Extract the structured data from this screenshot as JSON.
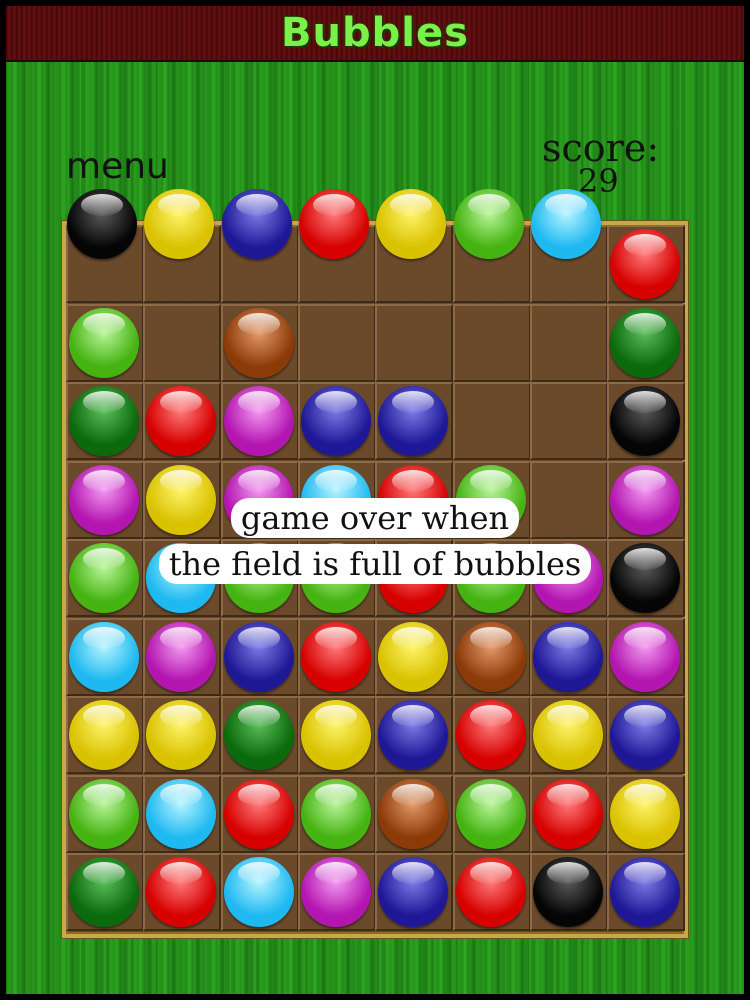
{
  "app": {
    "title": "Bubbles"
  },
  "menu": {
    "label": "menu"
  },
  "score": {
    "label": "score:",
    "value": "29"
  },
  "message": {
    "line1": "game over when",
    "line2": "the field is full of bubbles"
  },
  "colors": {
    "black": [
      "#5a5a5a",
      "#050505"
    ],
    "yellow": [
      "#fff46a",
      "#d9c200"
    ],
    "blue": [
      "#7d7be6",
      "#1e1896"
    ],
    "red": [
      "#ff7a7a",
      "#d60000"
    ],
    "lgreen": [
      "#b9f59a",
      "#45b312"
    ],
    "dgreen": [
      "#5bbd5b",
      "#0b6a0b"
    ],
    "cyan": [
      "#b7f4ff",
      "#1fb9f1"
    ],
    "magenta": [
      "#f39af0",
      "#b315b0"
    ],
    "brown": [
      "#e49a6a",
      "#8c3b08"
    ]
  },
  "board": {
    "columns": 8,
    "rows": 9,
    "top_row": [
      "black",
      "yellow",
      "blue",
      "red",
      "yellow",
      "lgreen",
      "cyan"
    ],
    "grid": [
      [
        null,
        null,
        null,
        null,
        null,
        null,
        null,
        "red"
      ],
      [
        "lgreen",
        null,
        "brown",
        null,
        null,
        null,
        null,
        "dgreen"
      ],
      [
        "dgreen",
        "red",
        "magenta",
        "blue",
        "blue",
        null,
        null,
        "black"
      ],
      [
        "magenta",
        "yellow",
        "magenta",
        "cyan",
        "red",
        "lgreen",
        null,
        "magenta"
      ],
      [
        "lgreen",
        "cyan",
        "lgreen",
        "lgreen",
        "red",
        "lgreen",
        "magenta",
        "black"
      ],
      [
        "cyan",
        "magenta",
        "blue",
        "red",
        "yellow",
        "brown",
        "blue",
        "magenta"
      ],
      [
        "yellow",
        "yellow",
        "dgreen",
        "yellow",
        "blue",
        "red",
        "yellow",
        "blue"
      ],
      [
        "lgreen",
        "cyan",
        "red",
        "lgreen",
        "brown",
        "lgreen",
        "red",
        "yellow"
      ],
      [
        "dgreen",
        "red",
        "cyan",
        "magenta",
        "blue",
        "red",
        "black",
        "blue"
      ]
    ]
  }
}
